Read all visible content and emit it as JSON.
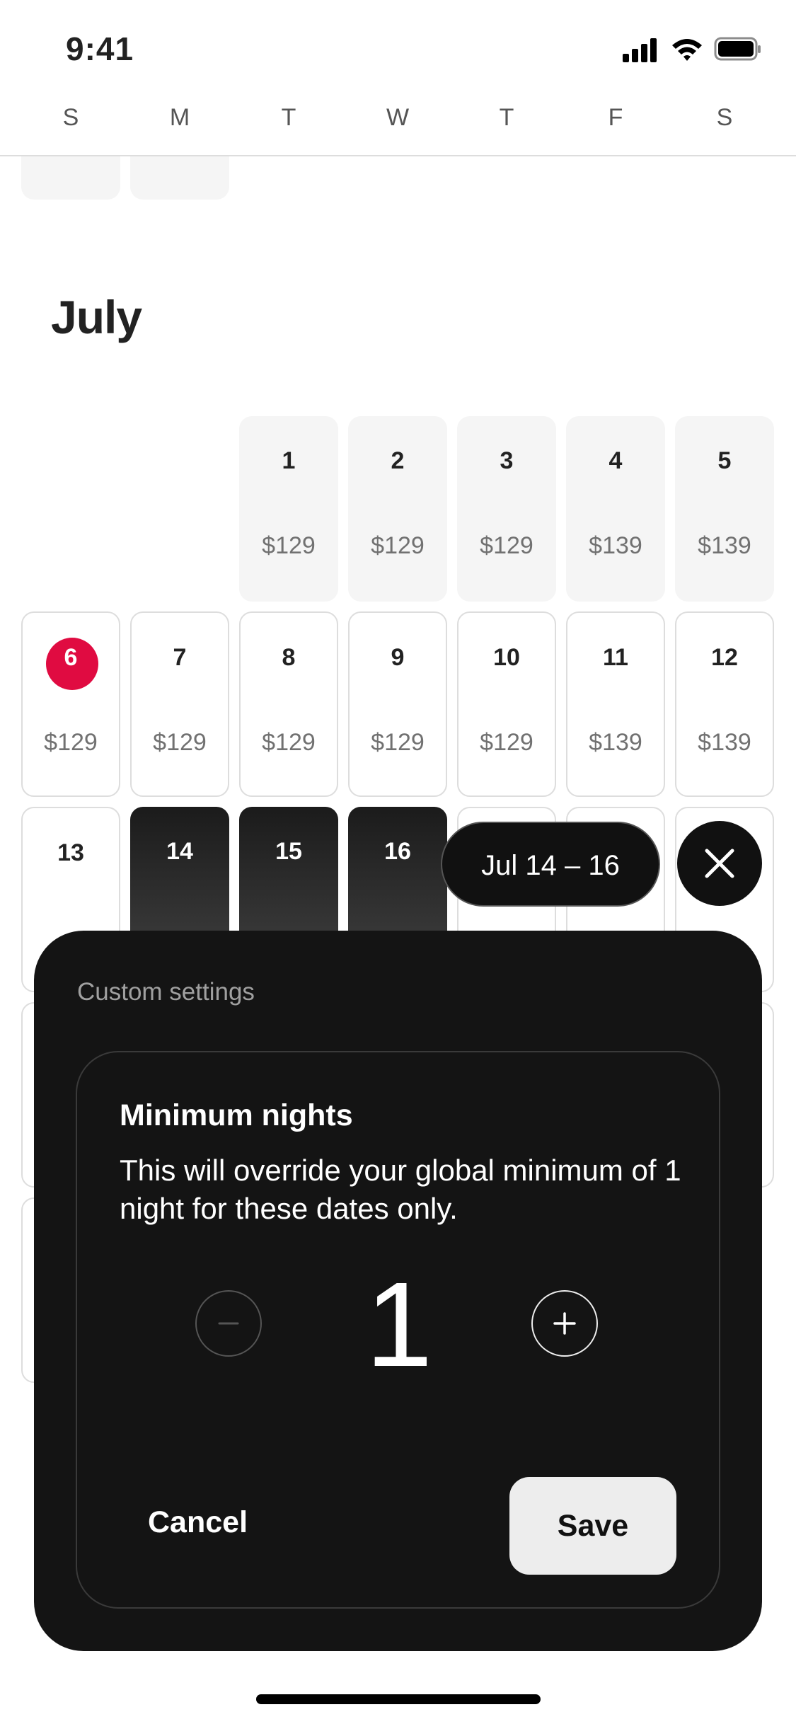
{
  "status_bar": {
    "time": "9:41"
  },
  "weekdays": [
    "S",
    "M",
    "T",
    "W",
    "T",
    "F",
    "S"
  ],
  "month_title": "July",
  "calendar": {
    "week1": [
      {
        "day": "1",
        "price": "$129"
      },
      {
        "day": "2",
        "price": "$129"
      },
      {
        "day": "3",
        "price": "$129"
      },
      {
        "day": "4",
        "price": "$139"
      },
      {
        "day": "5",
        "price": "$139"
      }
    ],
    "week2": [
      {
        "day": "6",
        "price": "$129"
      },
      {
        "day": "7",
        "price": "$129"
      },
      {
        "day": "8",
        "price": "$129"
      },
      {
        "day": "9",
        "price": "$129"
      },
      {
        "day": "10",
        "price": "$129"
      },
      {
        "day": "11",
        "price": "$139"
      },
      {
        "day": "12",
        "price": "$139"
      }
    ],
    "week3": [
      {
        "day": "13"
      },
      {
        "day": "14"
      },
      {
        "day": "15"
      },
      {
        "day": "16"
      }
    ]
  },
  "selection": {
    "range_label": "Jul 14 – 16"
  },
  "custom_settings": {
    "title": "Custom settings",
    "min_nights": {
      "title": "Minimum nights",
      "description": "This will override your global minimum of 1 night for these dates only.",
      "value": "1"
    },
    "cancel_label": "Cancel",
    "save_label": "Save"
  },
  "colors": {
    "accent": "#e00b41",
    "sheet": "#141414"
  },
  "icons": [
    "signal-icon",
    "wifi-icon",
    "battery-icon",
    "close-icon",
    "minus-icon",
    "plus-icon"
  ]
}
